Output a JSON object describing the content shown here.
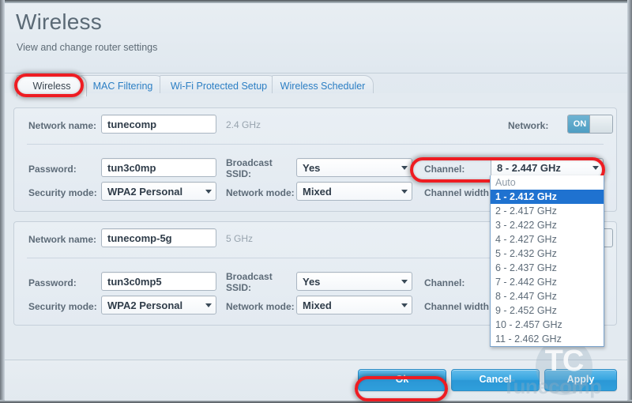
{
  "window": {
    "title": "Wireless",
    "subtitle": "View and change router settings"
  },
  "tabs": [
    {
      "label": "Wireless",
      "active": true
    },
    {
      "label": "MAC Filtering",
      "active": false
    },
    {
      "label": "Wi-Fi Protected Setup",
      "active": false
    },
    {
      "label": "Wireless Scheduler",
      "active": false
    }
  ],
  "labels": {
    "network_name": "Network name:",
    "password": "Password:",
    "security_mode": "Security mode:",
    "broadcast_ssid": "Broadcast SSID:",
    "broadcast_ssid_l1": "Broadcast",
    "broadcast_ssid_l2": "SSID:",
    "network_mode": "Network mode:",
    "channel": "Channel:",
    "channel_width": "Channel width:",
    "network": "Network:"
  },
  "band_24": {
    "band": "2.4 GHz",
    "network_name": "tunecomp",
    "password": "tun3c0mp",
    "security_mode": "WPA2 Personal",
    "broadcast_ssid": "Yes",
    "network_mode": "Mixed",
    "channel": "8 - 2.447 GHz",
    "network_toggle": "ON"
  },
  "band_5": {
    "band": "5 GHz",
    "network_name": "tunecomp-5g",
    "password": "tun3c0mp5",
    "security_mode": "WPA2 Personal",
    "broadcast_ssid": "Yes",
    "network_mode": "Mixed"
  },
  "channel_dropdown": {
    "open": true,
    "selected": "1 - 2.412 GHz",
    "options": [
      "Auto",
      "1 - 2.412 GHz",
      "2 - 2.417 GHz",
      "3 - 2.422 GHz",
      "4 - 2.427 GHz",
      "5 - 2.432 GHz",
      "6 - 2.437 GHz",
      "7 - 2.442 GHz",
      "8 - 2.447 GHz",
      "9 - 2.452 GHz",
      "10 - 2.457 GHz",
      "11 - 2.462 GHz"
    ]
  },
  "footer": {
    "ok": "Ok",
    "cancel": "Cancel",
    "apply": "Apply"
  },
  "watermark": {
    "mark": "TC",
    "text": "Tunecomp"
  },
  "colors": {
    "highlight": "#ee1c22",
    "accent_blue": "#2c7fc4",
    "selection_blue": "#1f72d0",
    "button_blue": "#36a5e0",
    "background": "#e3eaf0"
  }
}
